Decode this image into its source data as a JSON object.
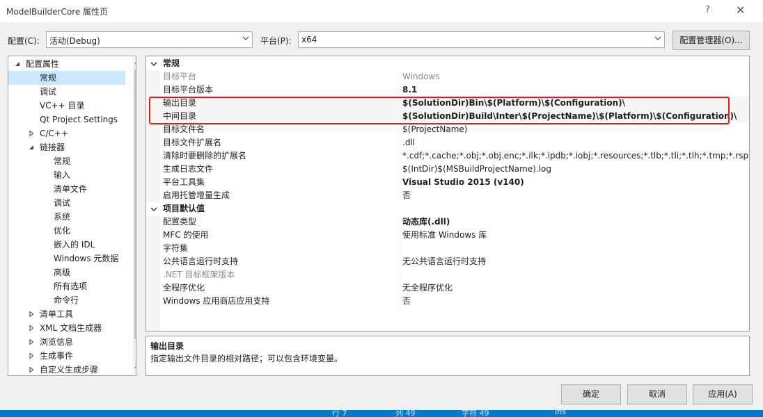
{
  "window": {
    "title": "ModelBuilderCore 属性页",
    "help": "?",
    "close": "✕"
  },
  "config": {
    "config_label": "配置(C):",
    "config_value": "活动(Debug)",
    "platform_label": "平台(P):",
    "platform_value": "x64",
    "manager_button": "配置管理器(O)..."
  },
  "tree": {
    "items": [
      {
        "label": "配置属性",
        "indent": 0,
        "expander": "expanded"
      },
      {
        "label": "常规",
        "indent": 1,
        "expander": "",
        "selected": true
      },
      {
        "label": "调试",
        "indent": 1,
        "expander": ""
      },
      {
        "label": "VC++ 目录",
        "indent": 1,
        "expander": ""
      },
      {
        "label": "Qt Project Settings",
        "indent": 1,
        "expander": ""
      },
      {
        "label": "C/C++",
        "indent": 1,
        "expander": "collapsed"
      },
      {
        "label": "链接器",
        "indent": 1,
        "expander": "expanded"
      },
      {
        "label": "常规",
        "indent": 2,
        "expander": ""
      },
      {
        "label": "输入",
        "indent": 2,
        "expander": ""
      },
      {
        "label": "清单文件",
        "indent": 2,
        "expander": ""
      },
      {
        "label": "调试",
        "indent": 2,
        "expander": ""
      },
      {
        "label": "系统",
        "indent": 2,
        "expander": ""
      },
      {
        "label": "优化",
        "indent": 2,
        "expander": ""
      },
      {
        "label": "嵌入的 IDL",
        "indent": 2,
        "expander": ""
      },
      {
        "label": "Windows 元数据",
        "indent": 2,
        "expander": ""
      },
      {
        "label": "高级",
        "indent": 2,
        "expander": ""
      },
      {
        "label": "所有选项",
        "indent": 2,
        "expander": ""
      },
      {
        "label": "命令行",
        "indent": 2,
        "expander": ""
      },
      {
        "label": "清单工具",
        "indent": 1,
        "expander": "collapsed"
      },
      {
        "label": "XML 文档生成器",
        "indent": 1,
        "expander": "collapsed"
      },
      {
        "label": "浏览信息",
        "indent": 1,
        "expander": "collapsed"
      },
      {
        "label": "生成事件",
        "indent": 1,
        "expander": "collapsed"
      },
      {
        "label": "自定义生成步骤",
        "indent": 1,
        "expander": "collapsed"
      }
    ]
  },
  "grid": {
    "rows": [
      {
        "type": "category",
        "name": "常规"
      },
      {
        "name": "目标平台",
        "value": "Windows",
        "style": "grey"
      },
      {
        "name": "目标平台版本",
        "value": "8.1",
        "style": "bold"
      },
      {
        "name": "输出目录",
        "value": "$(SolutionDir)Bin\\$(Platform)\\$(Configuration)\\",
        "style": "bold"
      },
      {
        "name": "中间目录",
        "value": "$(SolutionDir)Build\\Inter\\$(ProjectName)\\$(Platform)\\$(Configuration)\\",
        "style": "bold"
      },
      {
        "name": "目标文件名",
        "value": "$(ProjectName)",
        "style": ""
      },
      {
        "name": "目标文件扩展名",
        "value": ".dll",
        "style": ""
      },
      {
        "name": "清除时要删除的扩展名",
        "value": "*.cdf;*.cache;*.obj;*.obj.enc;*.ilk;*.ipdb;*.iobj;*.resources;*.tlb;*.tli;*.tlh;*.tmp;*.rsp;*.pgc;*.p",
        "style": ""
      },
      {
        "name": "生成日志文件",
        "value": "$(IntDir)$(MSBuildProjectName).log",
        "style": ""
      },
      {
        "name": "平台工具集",
        "value": "Visual Studio 2015 (v140)",
        "style": "bold"
      },
      {
        "name": "启用托管增量生成",
        "value": "否",
        "style": ""
      },
      {
        "type": "category",
        "name": "项目默认值"
      },
      {
        "name": "配置类型",
        "value": "动态库(.dll)",
        "style": "bold"
      },
      {
        "name": "MFC 的使用",
        "value": "使用标准 Windows 库",
        "style": ""
      },
      {
        "name": "字符集",
        "value": "",
        "style": ""
      },
      {
        "name": "公共语言运行时支持",
        "value": "无公共语言运行时支持",
        "style": ""
      },
      {
        "name": ".NET 目标框架版本",
        "value": "",
        "style": "greyname"
      },
      {
        "name": "全程序优化",
        "value": "无全程序优化",
        "style": ""
      },
      {
        "name": "Windows 应用商店应用支持",
        "value": "否",
        "style": ""
      }
    ]
  },
  "description": {
    "title": "输出目录",
    "text": "指定输出文件目录的相对路径；可以包含环境变量。"
  },
  "buttons": {
    "ok": "确定",
    "cancel": "取消",
    "apply": "应用(A)"
  },
  "statusbar": {
    "line": "行 7",
    "col": "列 49",
    "char": "字符 49",
    "ins": "Ins"
  },
  "colors": {
    "accent": "#007acc",
    "highlight": "#e31c1c",
    "selected": "#cce8ff"
  }
}
